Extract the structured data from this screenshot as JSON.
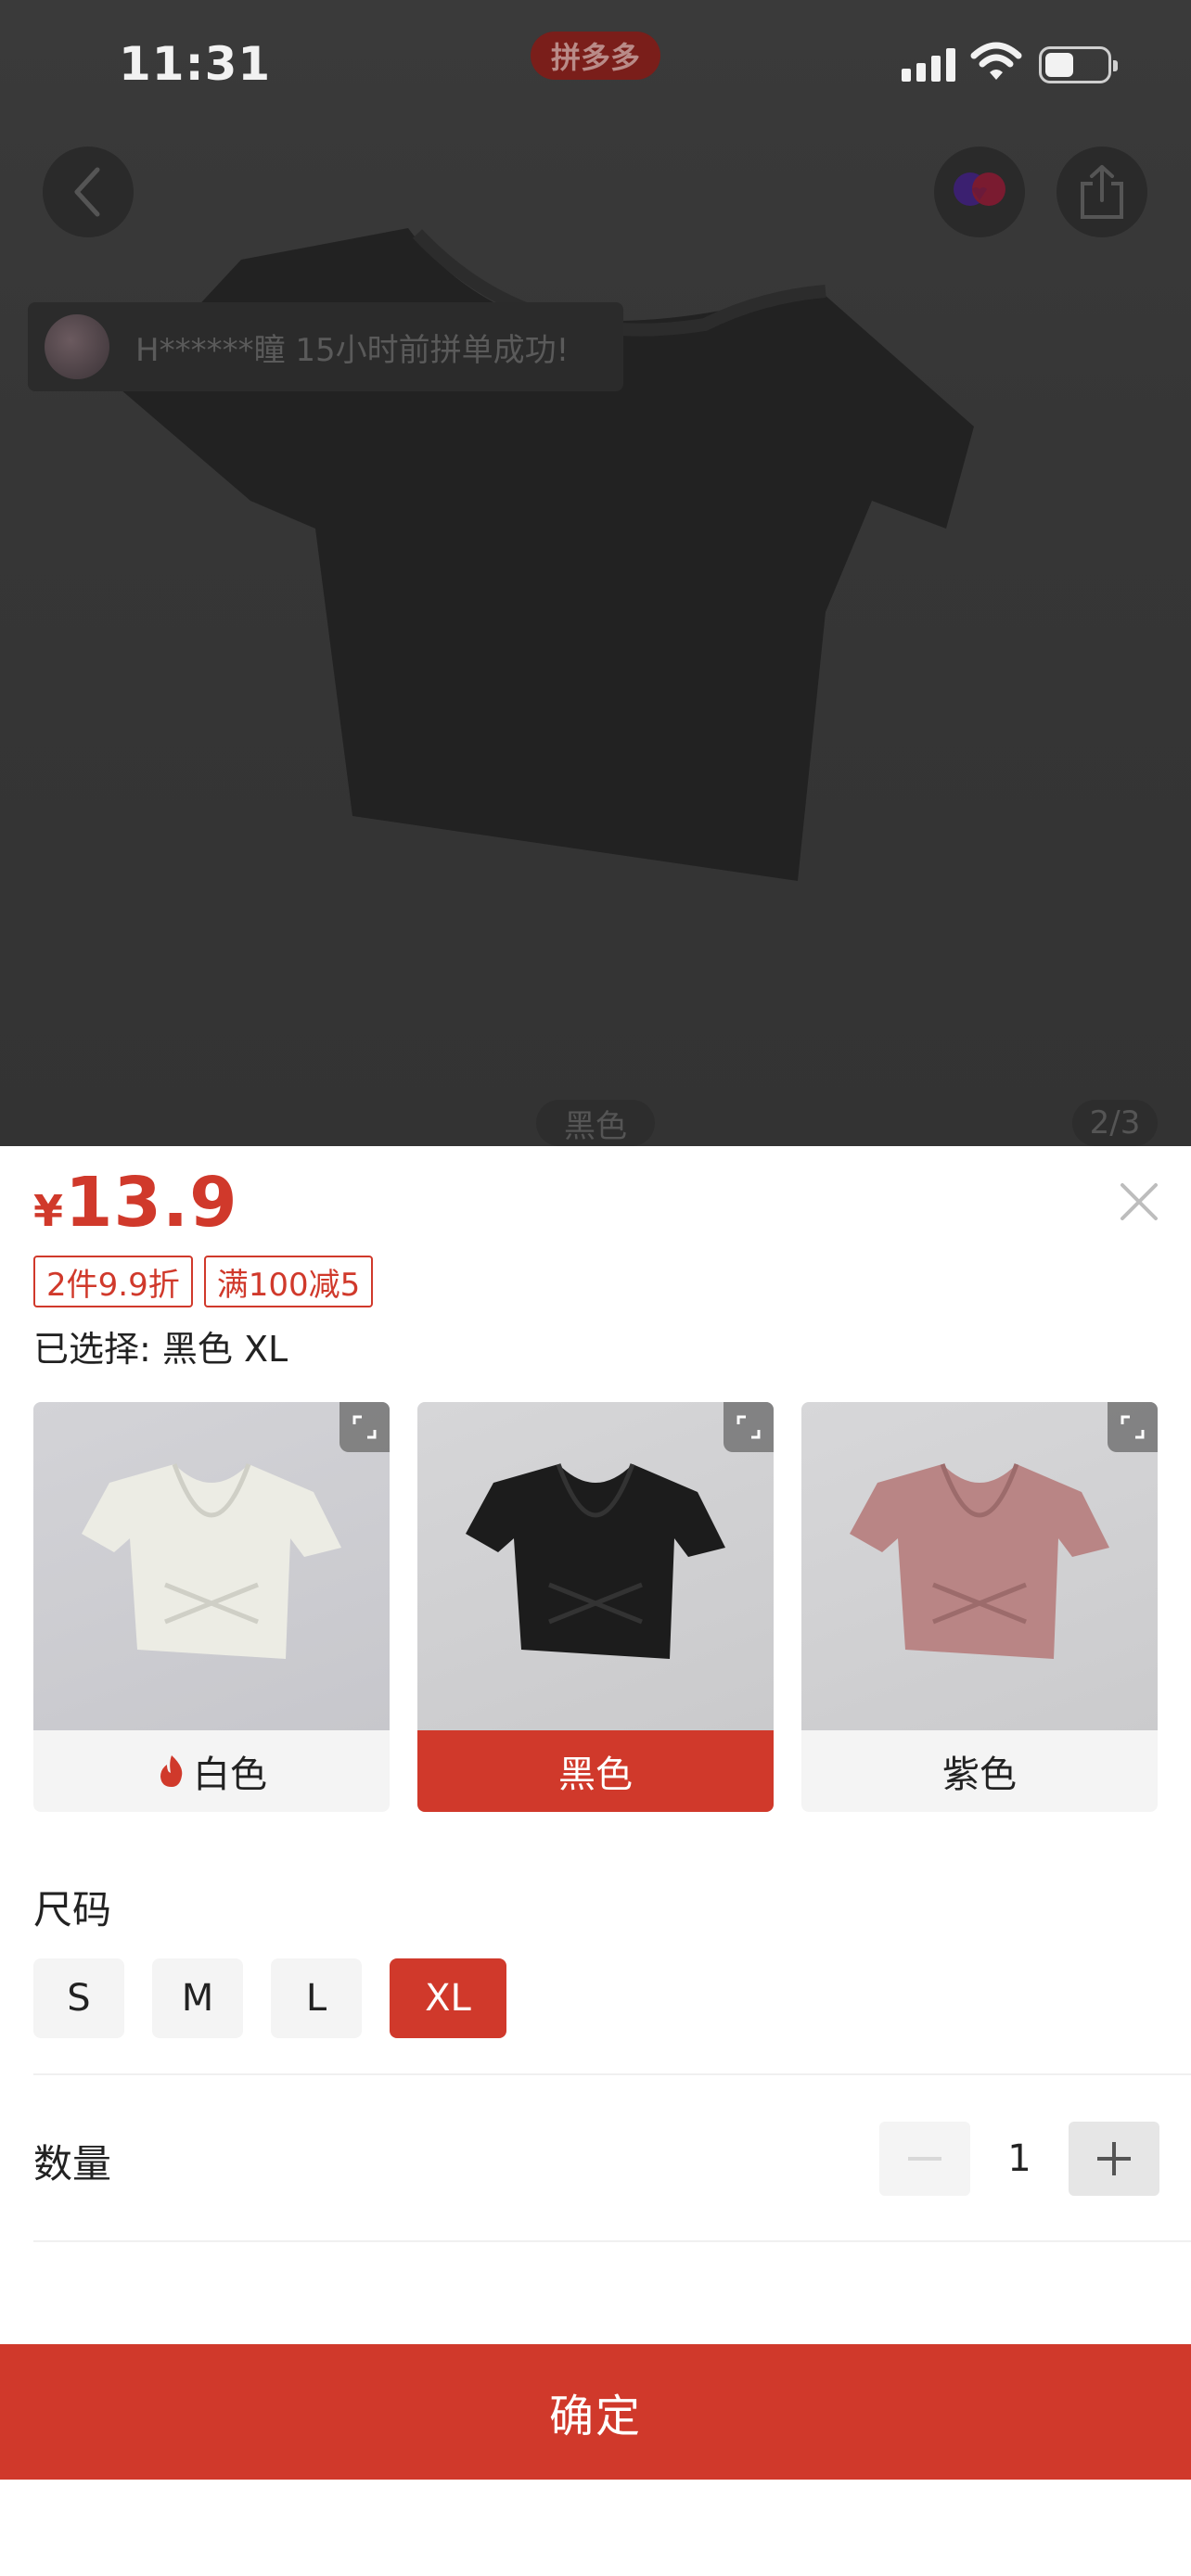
{
  "status_bar": {
    "time": "11:31",
    "app_badge": "拼多多"
  },
  "overlay": {
    "toast_text": "H******瞳 15小时前拼单成功!",
    "color_chip": "黑色",
    "page_indicator": "2/3"
  },
  "sheet": {
    "currency": "¥",
    "price": "13.9",
    "tags": [
      "2件9.9折",
      "满100减5"
    ],
    "selected_text": "已选择: 黑色 XL",
    "colors": [
      {
        "label": "白色",
        "hot": true,
        "shirt_color": "#eeeee6"
      },
      {
        "label": "黑色",
        "hot": false,
        "shirt_color": "#1c1c1c"
      },
      {
        "label": "紫色",
        "hot": false,
        "shirt_color": "#b98585"
      }
    ],
    "selected_color": "黑色",
    "size_title": "尺码",
    "sizes": [
      "S",
      "M",
      "L",
      "XL"
    ],
    "selected_size": "XL",
    "quantity_title": "数量",
    "quantity": "1",
    "confirm_label": "确定"
  },
  "colors": {
    "accent": "#d0392b"
  }
}
